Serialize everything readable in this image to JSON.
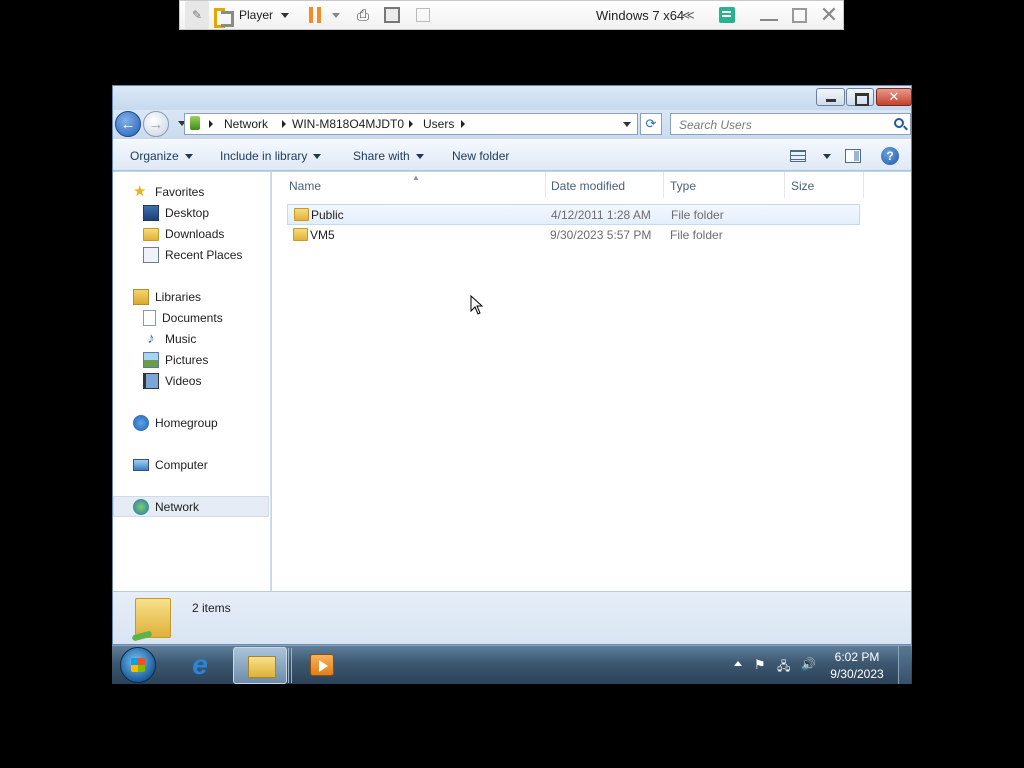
{
  "vm_toolbar": {
    "player_label": "Player",
    "vm_title": "Windows 7 x64",
    "collapse_glyph": "≪",
    "send_keys_glyph": "⎙"
  },
  "address": {
    "crumbs": [
      "Network",
      "WIN-M818O4MJDT0",
      "Users"
    ],
    "search_placeholder": "Search Users",
    "refresh_glyph": "⟳"
  },
  "commands": {
    "organize": "Organize",
    "include_in_library": "Include in library",
    "share_with": "Share with",
    "new_folder": "New folder",
    "help": "?"
  },
  "nav": {
    "favorites": "Favorites",
    "desktop": "Desktop",
    "downloads": "Downloads",
    "recent_places": "Recent Places",
    "libraries": "Libraries",
    "documents": "Documents",
    "music": "Music",
    "pictures": "Pictures",
    "videos": "Videos",
    "homegroup": "Homegroup",
    "computer": "Computer",
    "network": "Network",
    "star_glyph": "★",
    "music_glyph": "♪"
  },
  "columns": {
    "name": "Name",
    "date_modified": "Date modified",
    "type": "Type",
    "size": "Size",
    "sort_glyph": "▲"
  },
  "files": [
    {
      "name": "Public",
      "date": "4/12/2011 1:28 AM",
      "type": "File folder"
    },
    {
      "name": "VM5",
      "date": "9/30/2023 5:57 PM",
      "type": "File folder"
    }
  ],
  "details": {
    "item_count": "2 items"
  },
  "taskbar": {
    "ie_glyph": "e",
    "time": "6:02 PM",
    "date": "9/30/2023",
    "flag_glyph": "⚑",
    "network_glyph": "🖧",
    "volume_glyph": "🔊"
  },
  "colors": {
    "accent": "#3399ff",
    "window_frame": "#c3d7ec",
    "pause": "#f28c28"
  }
}
